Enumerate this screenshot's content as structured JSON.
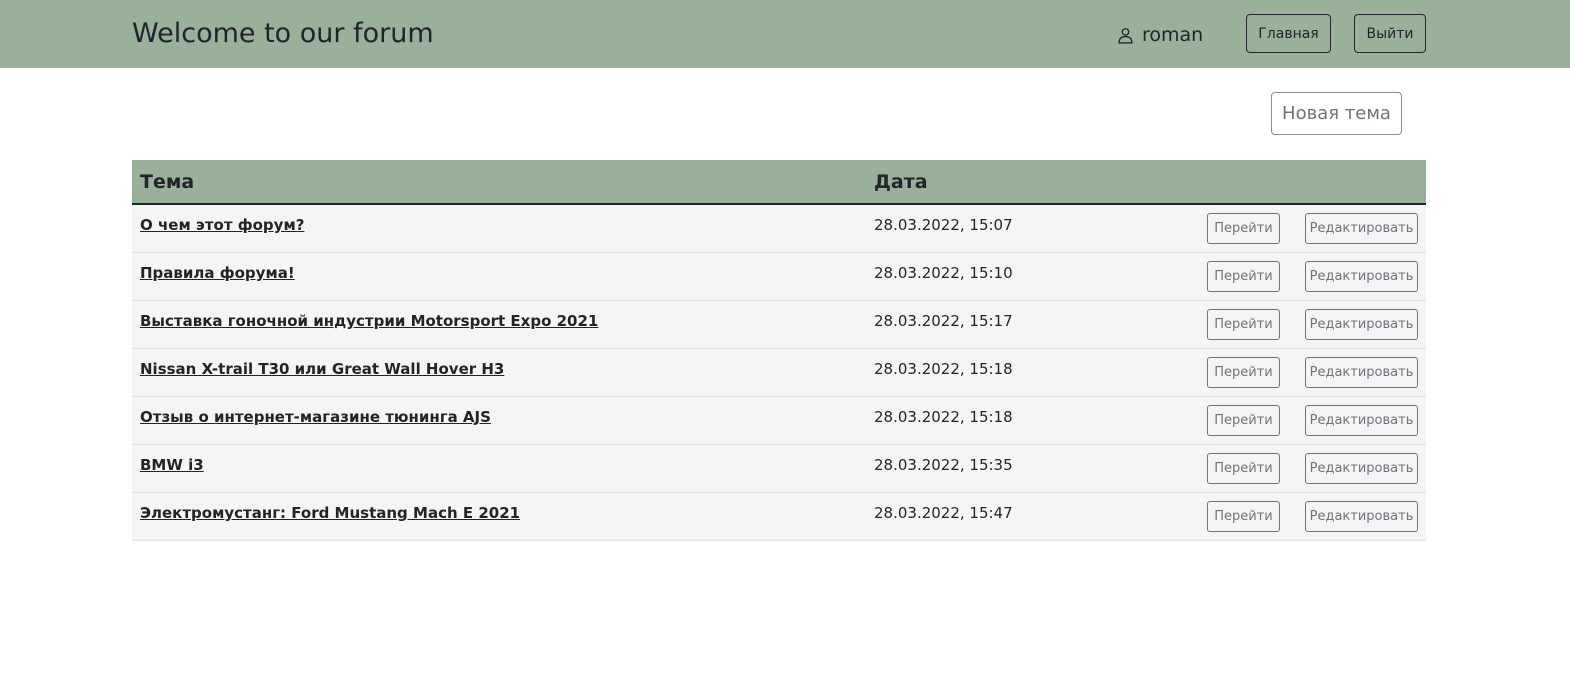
{
  "header": {
    "title": "Welcome to our forum",
    "username": "roman",
    "home_label": "Главная",
    "logout_label": "Выйти"
  },
  "actions": {
    "new_topic_label": "Новая тема"
  },
  "table": {
    "columns": [
      "Тема",
      "Дата"
    ],
    "go_label": "Перейти",
    "edit_label": "Редактировать",
    "rows": [
      {
        "topic": "О чем этот форум?",
        "date": "28.03.2022, 15:07"
      },
      {
        "topic": "Правила форума!",
        "date": "28.03.2022, 15:10"
      },
      {
        "topic": "Выставка гоночной индустрии Motorsport Expo 2021",
        "date": "28.03.2022, 15:17"
      },
      {
        "topic": "Nissan X-trail T30 или Great Wall Hover H3",
        "date": "28.03.2022, 15:18"
      },
      {
        "topic": "Отзыв о интернет-магазине тюнинга AJS",
        "date": "28.03.2022, 15:18"
      },
      {
        "topic": "BMW i3",
        "date": "28.03.2022, 15:35"
      },
      {
        "topic": "Электромустанг: Ford Mustang Mach E 2021",
        "date": "28.03.2022, 15:47"
      }
    ]
  },
  "icons": {
    "user": "person-icon"
  },
  "colors": {
    "header_bg": "#99b09b",
    "row_bg": "#f5f5f5"
  }
}
